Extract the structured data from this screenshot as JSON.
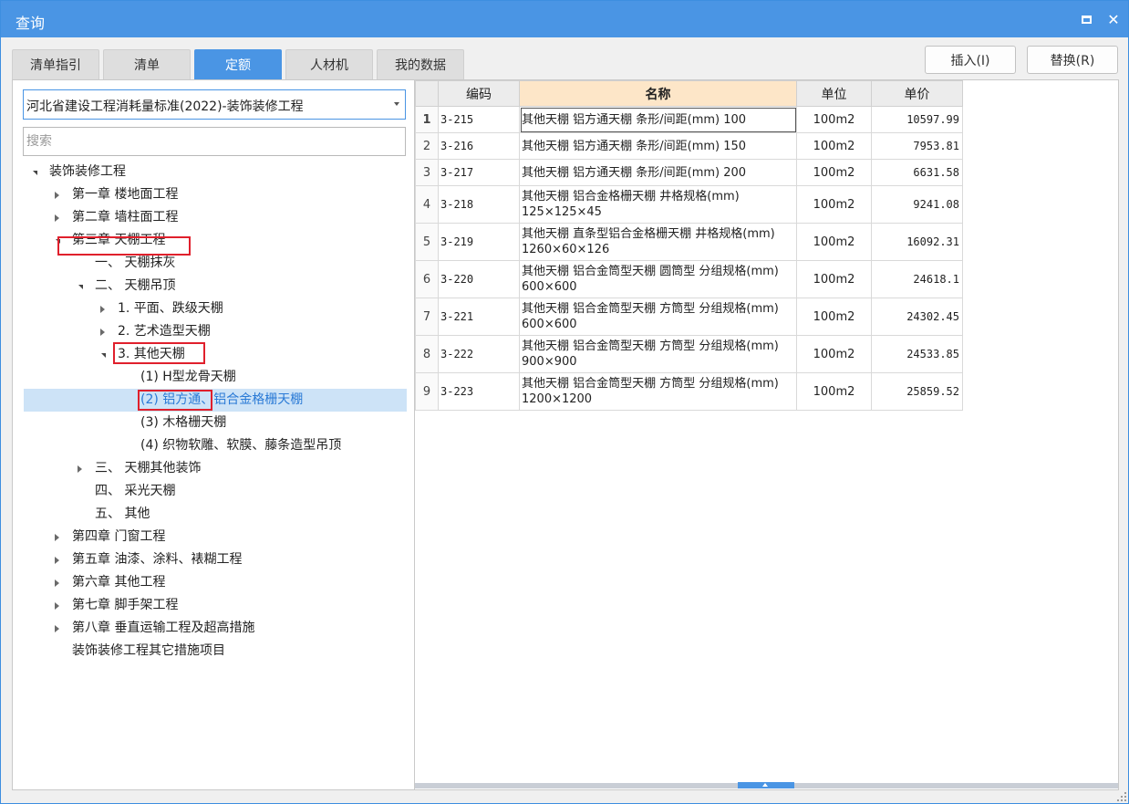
{
  "window": {
    "title": "查询"
  },
  "tabs": [
    {
      "label": "清单指引"
    },
    {
      "label": "清单"
    },
    {
      "label": "定额"
    },
    {
      "label": "人材机"
    },
    {
      "label": "我的数据"
    }
  ],
  "active_tab": "定额",
  "actions": {
    "insert": "插入(I)",
    "replace": "替换(R)"
  },
  "library": {
    "selected": "河北省建设工程消耗量标准(2022)-装饰装修工程"
  },
  "search": {
    "placeholder": "搜索"
  },
  "tree": [
    {
      "label": "装饰装修工程",
      "state": "expanded"
    },
    {
      "label": "第一章 楼地面工程",
      "state": "collapsed"
    },
    {
      "label": "第二章 墙柱面工程",
      "state": "collapsed"
    },
    {
      "label": "第三章 天棚工程",
      "state": "expanded",
      "highlighted": true
    },
    {
      "label": "一、 天棚抹灰",
      "state": "leaf"
    },
    {
      "label": "二、 天棚吊顶",
      "state": "expanded"
    },
    {
      "label": "1. 平面、跌级天棚",
      "state": "collapsed"
    },
    {
      "label": "2. 艺术造型天棚",
      "state": "collapsed"
    },
    {
      "label": "3. 其他天棚",
      "state": "expanded",
      "highlighted": true
    },
    {
      "label": "(1) H型龙骨天棚",
      "state": "leaf"
    },
    {
      "label": "(2) 铝方通、铝合金格栅天棚",
      "state": "leaf",
      "selected": true,
      "highlighted": true
    },
    {
      "label": "(3) 木格栅天棚",
      "state": "leaf"
    },
    {
      "label": "(4) 织物软雕、软膜、藤条造型吊顶",
      "state": "leaf"
    },
    {
      "label": "三、 天棚其他装饰",
      "state": "collapsed"
    },
    {
      "label": "四、 采光天棚",
      "state": "leaf"
    },
    {
      "label": "五、 其他",
      "state": "leaf"
    },
    {
      "label": "第四章 门窗工程",
      "state": "collapsed"
    },
    {
      "label": "第五章 油漆、涂料、裱糊工程",
      "state": "collapsed"
    },
    {
      "label": "第六章 其他工程",
      "state": "collapsed"
    },
    {
      "label": "第七章 脚手架工程",
      "state": "collapsed"
    },
    {
      "label": "第八章 垂直运输工程及超高措施",
      "state": "collapsed"
    },
    {
      "label": "装饰装修工程其它措施项目",
      "state": "leaf"
    }
  ],
  "grid": {
    "columns": {
      "code": "编码",
      "name": "名称",
      "unit": "单位",
      "price": "单价"
    },
    "rows": [
      {
        "no": "1",
        "code": "3-215",
        "name": "其他天棚 铝方通天棚 条形/间距(mm) 100",
        "unit": "100m2",
        "price": "10597.99"
      },
      {
        "no": "2",
        "code": "3-216",
        "name": "其他天棚 铝方通天棚 条形/间距(mm) 150",
        "unit": "100m2",
        "price": "7953.81"
      },
      {
        "no": "3",
        "code": "3-217",
        "name": "其他天棚 铝方通天棚 条形/间距(mm) 200",
        "unit": "100m2",
        "price": "6631.58"
      },
      {
        "no": "4",
        "code": "3-218",
        "name": "其他天棚 铝合金格栅天棚 井格规格(mm) 125×125×45",
        "unit": "100m2",
        "price": "9241.08"
      },
      {
        "no": "5",
        "code": "3-219",
        "name": "其他天棚 直条型铝合金格栅天棚 井格规格(mm) 1260×60×126",
        "unit": "100m2",
        "price": "16092.31"
      },
      {
        "no": "6",
        "code": "3-220",
        "name": "其他天棚 铝合金筒型天棚 圆筒型 分组规格(mm) 600×600",
        "unit": "100m2",
        "price": "24618.1"
      },
      {
        "no": "7",
        "code": "3-221",
        "name": "其他天棚 铝合金筒型天棚 方筒型 分组规格(mm) 600×600",
        "unit": "100m2",
        "price": "24302.45"
      },
      {
        "no": "8",
        "code": "3-222",
        "name": "其他天棚 铝合金筒型天棚 方筒型 分组规格(mm) 900×900",
        "unit": "100m2",
        "price": "24533.85"
      },
      {
        "no": "9",
        "code": "3-223",
        "name": "其他天棚 铝合金筒型天棚 方筒型 分组规格(mm) 1200×1200",
        "unit": "100m2",
        "price": "25859.52"
      }
    ]
  },
  "colors": {
    "accent": "#4a95e4",
    "selection": "#cde3f7",
    "highlight": "#e0202c",
    "name_header": "#fde6c8"
  }
}
